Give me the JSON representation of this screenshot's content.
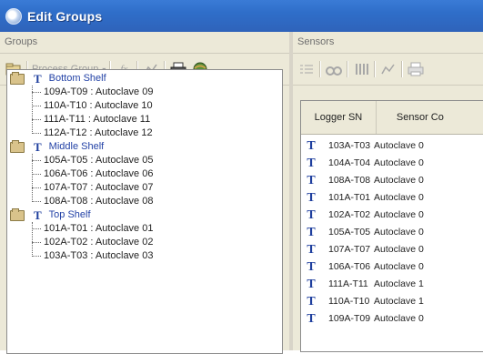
{
  "window": {
    "title": "Edit Groups"
  },
  "groups_pane": {
    "header": "Groups",
    "toolbar": {
      "process_group_label": "Process Group"
    },
    "groups": [
      {
        "label": "Bottom Shelf",
        "items": [
          "109A-T09 : Autoclave 09",
          "110A-T10 : Autoclave 10",
          "111A-T11 : Autoclave 11",
          "112A-T12 : Autoclave 12"
        ]
      },
      {
        "label": "Middle Shelf",
        "items": [
          "105A-T05 : Autoclave 05",
          "106A-T06 : Autoclave 06",
          "107A-T07 : Autoclave 07",
          "108A-T08 : Autoclave 08"
        ]
      },
      {
        "label": "Top Shelf",
        "items": [
          "101A-T01 : Autoclave 01",
          "102A-T02 : Autoclave 02",
          "103A-T03 : Autoclave 03"
        ]
      }
    ],
    "type_glyph": "T"
  },
  "sensors_pane": {
    "header": "Sensors",
    "columns": [
      "Logger SN",
      "Sensor Co"
    ],
    "rows": [
      {
        "sn": "103A-T03",
        "sc": "Autoclave 0"
      },
      {
        "sn": "104A-T04",
        "sc": "Autoclave 0"
      },
      {
        "sn": "108A-T08",
        "sc": "Autoclave 0"
      },
      {
        "sn": "101A-T01",
        "sc": "Autoclave 0"
      },
      {
        "sn": "102A-T02",
        "sc": "Autoclave 0"
      },
      {
        "sn": "105A-T05",
        "sc": "Autoclave 0"
      },
      {
        "sn": "107A-T07",
        "sc": "Autoclave 0"
      },
      {
        "sn": "106A-T06",
        "sc": "Autoclave 0"
      },
      {
        "sn": "111A-T11",
        "sc": "Autoclave 1"
      },
      {
        "sn": "110A-T10",
        "sc": "Autoclave 1"
      },
      {
        "sn": "109A-T09",
        "sc": "Autoclave 0"
      }
    ]
  },
  "colors": {
    "titlebar": "#2f6ec9",
    "group_label": "#2342a6",
    "type_glyph": "#1f3f9e"
  }
}
